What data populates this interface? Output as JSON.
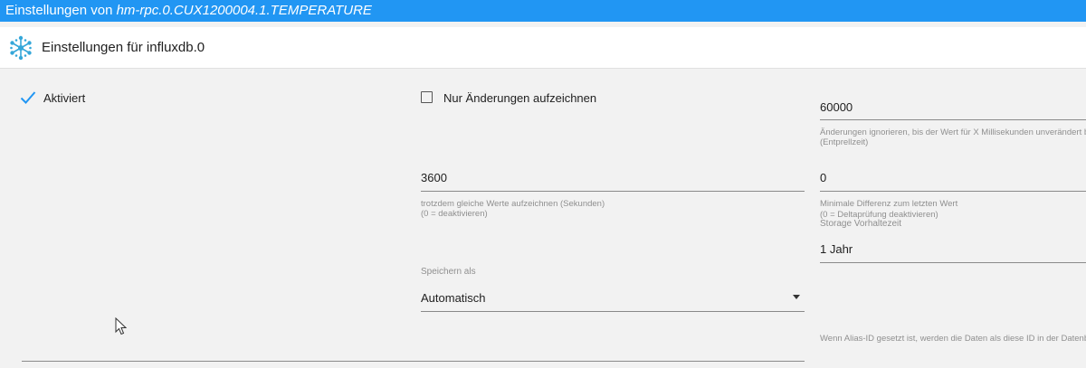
{
  "window": {
    "title_prefix": "Einstellungen von ",
    "object_id": "hm-rpc.0.CUX1200004.1.TEMPERATURE"
  },
  "header": {
    "title": "Einstellungen für influxdb.0"
  },
  "colors": {
    "titlebar": "#2196f3",
    "accent": "#2196f3",
    "background": "#f2f2f2"
  },
  "settings": {
    "enabled_label": "Aktiviert",
    "enabled_checked": true,
    "changes_only_label": "Nur Änderungen aufzeichnen",
    "changes_only_checked": false,
    "debounce_value": "60000",
    "debounce_help_line1": "Änderungen ignorieren, bis der Wert für X Millisekunden unverändert blei",
    "debounce_help_line2": "(Entprellzeit)",
    "still_record_value": "3600",
    "still_record_help_line1": "trotzdem gleiche Werte aufzeichnen (Sekunden)",
    "still_record_help_line2": "(0 = deaktivieren)",
    "min_diff_value": "0",
    "min_diff_help_line1": "Minimale Differenz zum letzten Wert",
    "min_diff_help_line2": "(0 = Deltaprüfung deaktivieren)",
    "retention_label": "Storage Vorhaltezeit",
    "retention_value": "1 Jahr",
    "store_as_label": "Speichern als",
    "store_as_value": "Automatisch",
    "alias_help": "Wenn Alias-ID gesetzt ist, werden die Daten als diese ID in der Datenbank"
  }
}
